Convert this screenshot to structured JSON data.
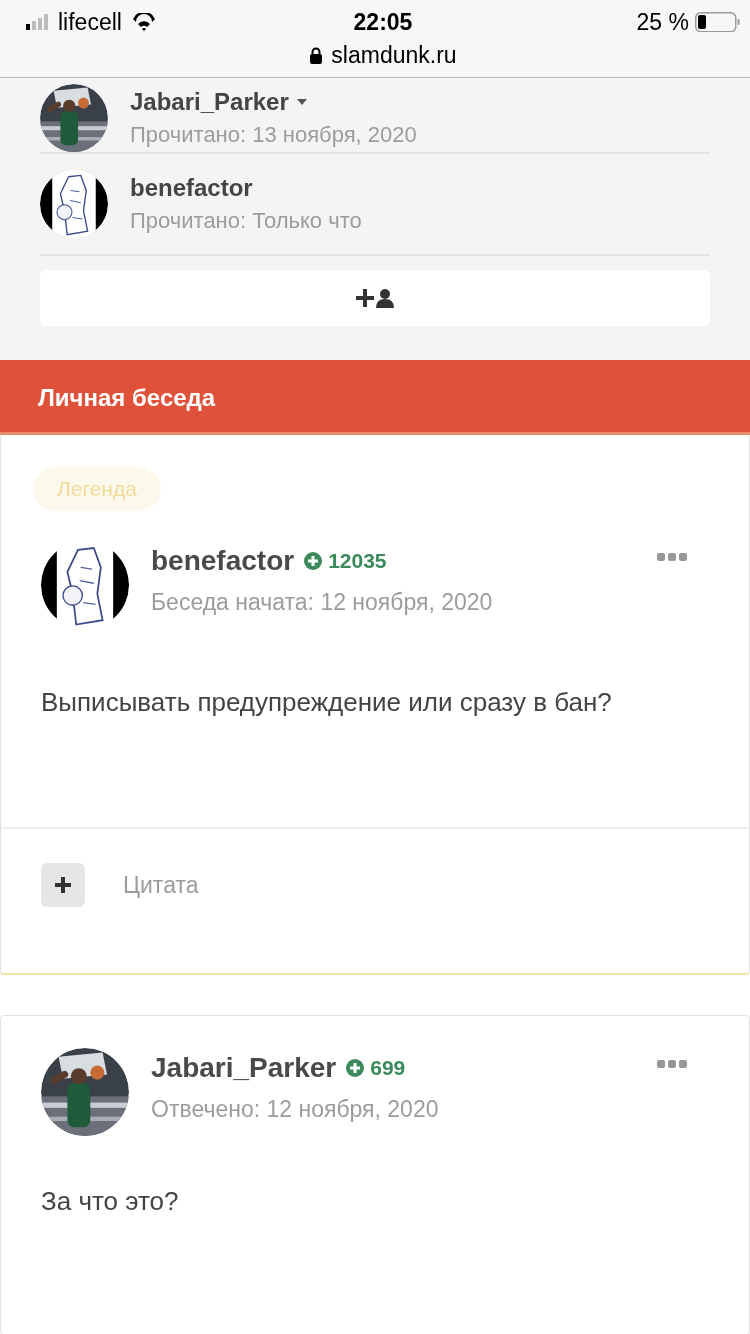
{
  "status_bar": {
    "carrier": "lifecell",
    "time": "22:05",
    "battery": "25 %",
    "url": "slamdunk.ru"
  },
  "participants": [
    {
      "name": "Jabari_Parker",
      "has_menu": true,
      "read": "Прочитано: 13 ноября, 2020"
    },
    {
      "name": "benefactor",
      "has_menu": false,
      "read": "Прочитано: Только что"
    }
  ],
  "section_title": "Личная беседа",
  "posts": [
    {
      "badge": "Легенда",
      "author": "benefactor",
      "reputation": "12035",
      "meta": "Беседа начата: 12 ноября, 2020",
      "body": "Выписывать предупреждение или сразу в бан?",
      "quote_label": "Цитата"
    },
    {
      "author": "Jabari_Parker",
      "reputation": "699",
      "meta": "Отвечено: 12 ноября, 2020",
      "body": "За что это?"
    }
  ]
}
